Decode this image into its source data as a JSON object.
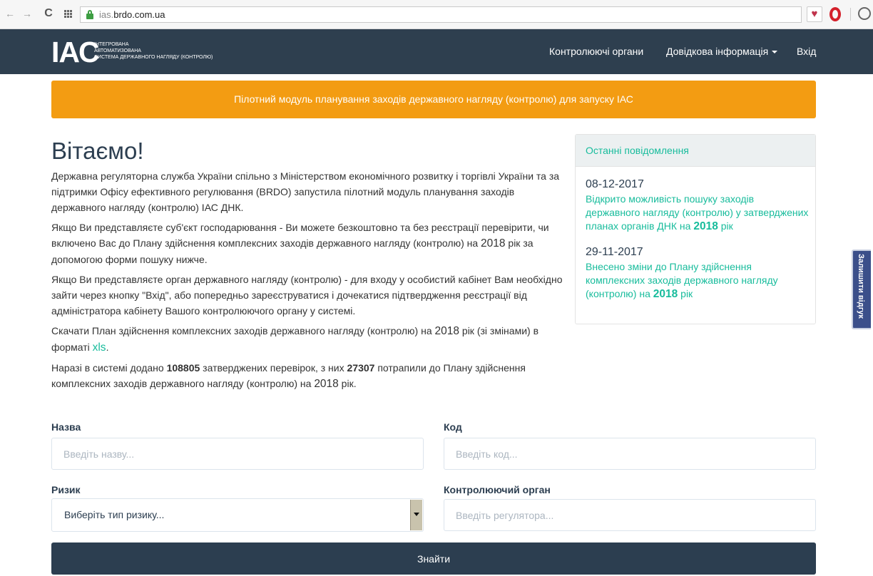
{
  "browser": {
    "url_prefix": "ias.",
    "url_domain": "brdo.com.ua",
    "back_icon": "←",
    "forward_icon": "→",
    "reload_icon": "C",
    "heart_icon": "♥"
  },
  "navbar": {
    "logo_text": "ІАС",
    "logo_line1": "ІНТЕГРОВАНА",
    "logo_line2": "АВТОМАТИЗОВАНА",
    "logo_line3": "СИСТЕМА ДЕРЖАВНОГО НАГЛЯДУ (КОНТРОЛЮ)",
    "links": [
      {
        "label": "Контролюючі органи"
      },
      {
        "label": "Довідкова інформація"
      },
      {
        "label": "Вхід"
      }
    ]
  },
  "banner": {
    "text": "Пілотний модуль планування заходів державного нагляду (контролю) для запуску ІАС"
  },
  "welcome": {
    "title": "Вітаємо!",
    "p1": "Державна регуляторна служба України спільно з Міністерством економічного розвитку і торгівлі України та за підтримки Офісу ефективного регулювання (BRDO) запустила пілотний модуль планування заходів державного нагляду (контролю) ІАС ДНК.",
    "p2_before": "Якщо Ви представляєте суб'єкт господарювання - Ви можете безкоштовно та без реєстрації перевірити, чи включено Вас до Плану здійснення комплексних заходів державного нагляду (контролю) на ",
    "p2_year": "2018",
    "p2_after": " рік за допомогою форми пошуку нижче.",
    "p3": "Якщо Ви представляєте орган державного нагляду (контролю) - для входу у особистий кабінет Вам необхідно зайти через кнопку \"Вхід\", або попередньо зареєструватися і дочекатися підтвердження реєстрації від адміністратора кабінету Вашого контролюючого органу у системі.",
    "p4_before": "Скачати План здійснення комплексних заходів державного нагляду (контролю) на ",
    "p4_year": "2018",
    "p4_middle": " рік (зі змінами) в форматі ",
    "p4_link": "xls",
    "p4_after": ".",
    "p5_before": "Наразі в системі додано ",
    "p5_count1": "108805",
    "p5_middle": " затверджених перевірок, з них ",
    "p5_count2": "27307",
    "p5_after1": " потрапили до Плану здійснення комплексних заходів державного нагляду (контролю) на ",
    "p5_year": "2018",
    "p5_after2": " рік."
  },
  "news_panel": {
    "title": "Останні повідомлення",
    "items": [
      {
        "date": "08-12-2017",
        "text": "Відкрито можливість пошуку заходів державного нагляду (контролю) у затверджених планах органів ДНК на ",
        "year": "2018",
        "suffix": " рік"
      },
      {
        "date": "29-11-2017",
        "text": "Внесено зміни до Плану здійснення комплексних заходів державного нагляду (контролю) на ",
        "year": "2018",
        "suffix": " рік"
      }
    ]
  },
  "feedback_tab": {
    "label": "Залишити відгук"
  },
  "form": {
    "name_label": "Назва",
    "name_placeholder": "Введіть назву...",
    "code_label": "Код",
    "code_placeholder": "Введіть код...",
    "risk_label": "Ризик",
    "risk_selected": "Виберіть тип ризику...",
    "regulator_label": "Контролюючий орган",
    "regulator_placeholder": "Введіть регулятора...",
    "search_button": "Знайти"
  },
  "colors": {
    "navbar": "#2e3f4f",
    "banner": "#f39c12",
    "accent": "#18bc9c",
    "button": "#2c3e50"
  }
}
